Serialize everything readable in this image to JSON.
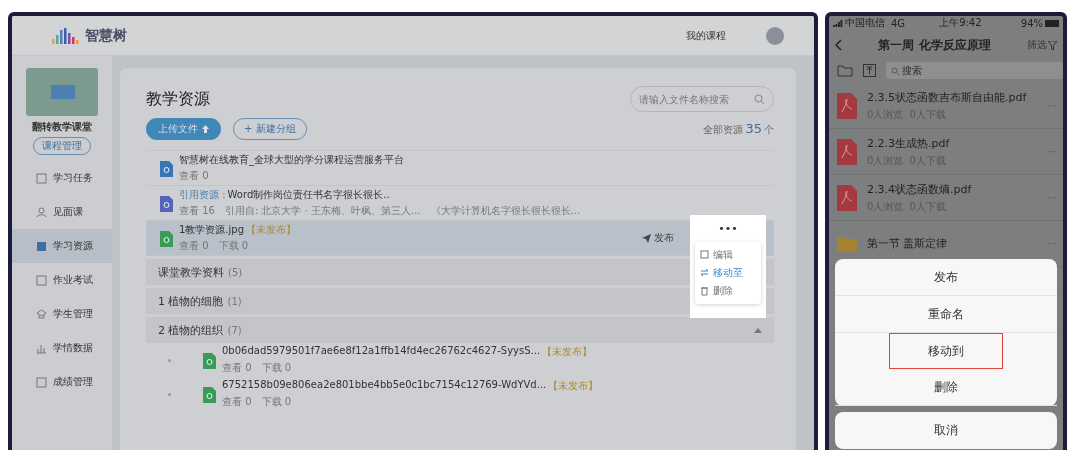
{
  "web": {
    "logo": "智慧树",
    "nav_link": "我的课程",
    "sidebar": {
      "course_title": "翻转教学课堂",
      "manage_button": "课程管理",
      "items": [
        {
          "label": "学习任务",
          "kind": "task",
          "selected": false
        },
        {
          "label": "见面课",
          "kind": "person",
          "selected": false
        },
        {
          "label": "学习资源",
          "kind": "resource",
          "selected": true
        },
        {
          "label": "作业考试",
          "kind": "exam",
          "selected": false
        },
        {
          "label": "学生管理",
          "kind": "student",
          "selected": false
        },
        {
          "label": "学情数据",
          "kind": "chart",
          "selected": false
        },
        {
          "label": "成绩管理",
          "kind": "grade",
          "selected": false
        }
      ]
    },
    "main": {
      "title": "教学资源",
      "upload_button": "上传文件",
      "new_group_button": "+ 新建分组",
      "search": {
        "placeholder": "请输入文件名称搜索"
      },
      "total_label": "全部资源",
      "total_count": "35",
      "total_unit": "个",
      "files": [
        {
          "kind": "link",
          "title": "智慧树在线教育_全球大型的学分课程运营服务平台",
          "meta": [
            "查看 0"
          ],
          "selected": false
        },
        {
          "kind": "quote",
          "prefix": "引用资源 :",
          "title": "Word制作岗位责任书名字很长很长..",
          "meta": [
            "查看 16",
            "引用自: 北京大学 · 王东梅、叶枫、第三人...",
            "《大学计算机名字很长很长很长..."
          ],
          "selected": false
        },
        {
          "kind": "image",
          "title": "1教学资源.jpg",
          "status": "【未发布】",
          "meta": [
            "查看 0",
            "下载 0"
          ],
          "selected": true,
          "publish": "发布",
          "more": "•••",
          "menu": [
            {
              "label": "编辑",
              "kind": "edit",
              "selected": false
            },
            {
              "label": "移动至",
              "kind": "move",
              "selected": true
            },
            {
              "label": "删除",
              "kind": "delete",
              "selected": false
            }
          ]
        }
      ],
      "groups": [
        {
          "title": "课堂教学资料",
          "count": "(5)"
        },
        {
          "title": "1 植物的细胞",
          "count": "(1)"
        },
        {
          "title": "2 植物的组织",
          "count": "(7)",
          "expanded": true,
          "children": [
            {
              "title": "0b06dad5979501f7ae6e8f12a1ffb14fd4ec26762c4627-SyysS...",
              "status": "【未发布】",
              "meta": [
                "查看 0",
                "下载 0"
              ]
            },
            {
              "title": "6752158b09e806ea2e801bbe4bb5e0c1bc7154c12769-WdYVd...",
              "status": "【未发布】",
              "meta": [
                "查看 0",
                "下载 0"
              ]
            }
          ]
        }
      ]
    }
  },
  "phone": {
    "status": {
      "carrier": "中国电信",
      "network": "4G",
      "time": "上午9:42",
      "battery": "94%"
    },
    "title": "第一周 化学反应原理",
    "filter": "筛选",
    "search": {
      "placeholder": "搜索"
    },
    "items": [
      {
        "kind": "pdf",
        "name": "2.3.5状态函数吉布斯自由能.pdf",
        "meta": [
          "0人浏览",
          "0人下载"
        ],
        "more": "···"
      },
      {
        "kind": "pdf",
        "name": "2.2.3生成热.pdf",
        "meta": [
          "0人浏览",
          "0人下载"
        ],
        "more": "···"
      },
      {
        "kind": "pdf",
        "name": "2.3.4状态函数熵.pdf",
        "meta": [
          "0人浏览",
          "0人下载"
        ],
        "more": "···"
      },
      {
        "kind": "folder",
        "name": "第一节 盖斯定律",
        "more": "···"
      }
    ],
    "action_sheet": {
      "options": [
        {
          "label": "发布",
          "selected": false
        },
        {
          "label": "重命名",
          "selected": false
        },
        {
          "label": "移动到",
          "selected": true
        },
        {
          "label": "删除",
          "selected": false
        }
      ],
      "cancel": "取消"
    }
  }
}
